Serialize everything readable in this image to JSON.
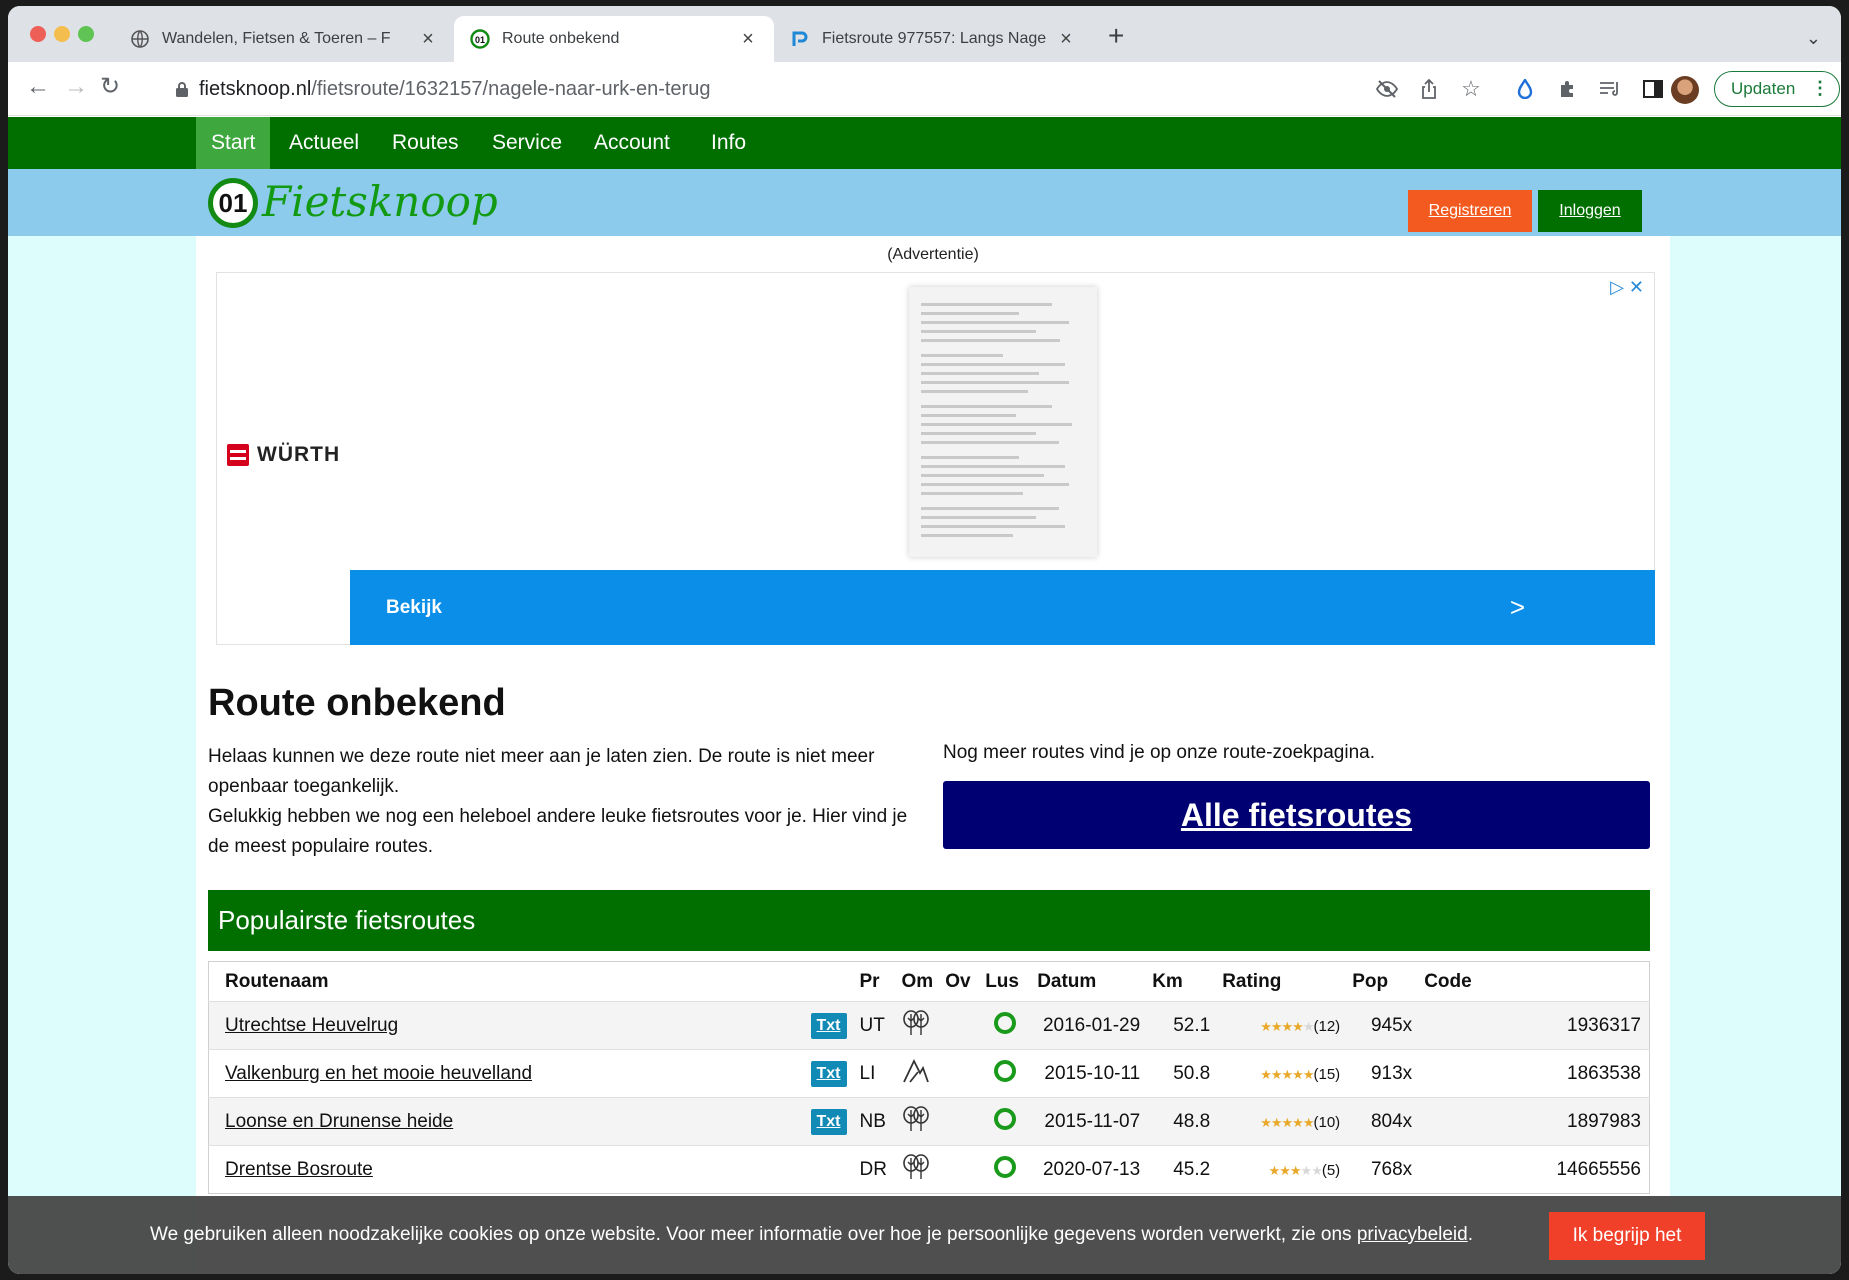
{
  "browser": {
    "tabs": [
      {
        "title": "Wandelen, Fietsen & Toeren – F",
        "icon": "globe-icon"
      },
      {
        "title": "Route onbekend",
        "icon": "fietsknoop-icon"
      },
      {
        "title": "Fietsroute 977557: Langs Nage",
        "icon": "route-r-icon"
      }
    ],
    "url_domain": "fietsknoop.nl",
    "url_path": "/fietsroute/1632157/nagele-naar-urk-en-terug",
    "update_label": "Updaten"
  },
  "nav": {
    "items": [
      "Start",
      "Actueel",
      "Routes",
      "Service",
      "Account",
      "Info"
    ]
  },
  "brand": {
    "logo_number": "01",
    "logo_text": "Fietsknoop",
    "register_label": "Registreren",
    "login_label": "Inloggen",
    "colors": {
      "register": "#f35a1f",
      "login": "#006f00"
    }
  },
  "ad": {
    "label": "(Advertentie)",
    "advertiser": "WÜRTH",
    "cta_label": "Bekijk",
    "cta_arrow": ">"
  },
  "main": {
    "title": "Route onbekend",
    "intro_line1": "Helaas kunnen we deze route niet meer aan je laten zien. De route is niet meer openbaar toegankelijk.",
    "intro_line2": "Gelukkig hebben we nog een heleboel andere leuke fietsroutes voor je. Hier vind je de meest populaire routes.",
    "more_text": "Nog meer routes vind je op onze route-zoekpagina.",
    "all_routes_label": "Alle fietsroutes"
  },
  "popular": {
    "header": "Populairste fietsroutes",
    "columns": [
      "Routenaam",
      "Pr",
      "Om",
      "Ov",
      "Lus",
      "Datum",
      "Km",
      "Rating",
      "Pop",
      "Code"
    ],
    "rows": [
      {
        "name": "Utrechtse Heuvelrug",
        "txt": "Txt",
        "province": "UT",
        "terrain": "forest-icon",
        "date": "2016-01-29",
        "km": "52.1",
        "stars": 4,
        "rating_count": "(12)",
        "pop": "945x",
        "code": "1936317"
      },
      {
        "name": "Valkenburg en het mooie heuvelland",
        "txt": "Txt",
        "province": "LI",
        "terrain": "mountain-icon",
        "date": "2015-10-11",
        "km": "50.8",
        "stars": 5,
        "rating_count": "(15)",
        "pop": "913x",
        "code": "1863538"
      },
      {
        "name": "Loonse en Drunense heide",
        "txt": "Txt",
        "province": "NB",
        "terrain": "forest-icon",
        "date": "2015-11-07",
        "km": "48.8",
        "stars": 5,
        "rating_count": "(10)",
        "pop": "804x",
        "code": "1897983"
      },
      {
        "name": "Drentse Bosroute",
        "txt": "",
        "province": "DR",
        "terrain": "forest-icon",
        "date": "2020-07-13",
        "km": "45.2",
        "stars": 3,
        "rating_count": "(5)",
        "pop": "768x",
        "code": "14665556"
      }
    ]
  },
  "cookie": {
    "text": "We gebruiken alleen noodzakelijke cookies op onze website. Voor meer informatie over hoe je persoonlijke gegevens worden verwerkt, zie ons ",
    "link": "privacybeleid",
    "suffix": ".",
    "button": "Ik begrijp het"
  }
}
